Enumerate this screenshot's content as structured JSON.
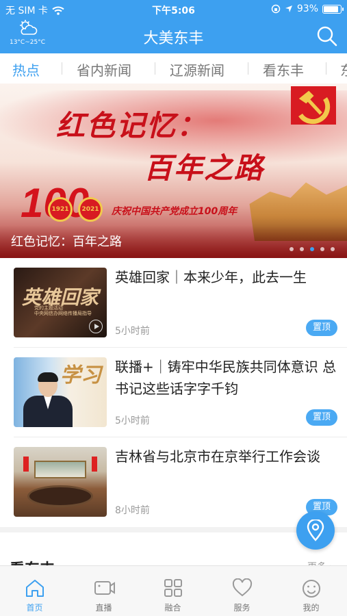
{
  "status_bar": {
    "carrier": "无 SIM 卡",
    "time": "下午5:06",
    "battery": "93%",
    "battery_level": 0.93
  },
  "header": {
    "title": "大美东丰",
    "weather_temp": "13°C~25°C",
    "weather_icon": "partly-cloudy-icon",
    "search_icon": "search-icon"
  },
  "tabs": [
    "热点",
    "省内新闻",
    "辽源新闻",
    "看东丰",
    "东"
  ],
  "active_tab": "热点",
  "banner": {
    "headline_1": "红色记忆：",
    "headline_2": "百年之路",
    "big_number": "100",
    "year_start": "1921",
    "year_end": "2021",
    "slogan": "庆祝中国共产党成立100周年",
    "caption": "红色记忆：百年之路",
    "slide_count": 5,
    "active_slide": 3
  },
  "news": [
    {
      "title": "英雄回家｜本来少年，此去一生",
      "time": "5小时前",
      "pin": "置顶",
      "thumb_text": "英雄回家",
      "thumb_sub": "中央网信办网络传播局指导",
      "thumb_sub_top": "党的主题活动",
      "thumb_icon": "play-icon"
    },
    {
      "title": "联播+｜铸牢中华民族共同体意识 总书记这些话字字千钧",
      "time": "5小时前",
      "pin": "置顶",
      "thumb_text": "学习"
    },
    {
      "title": "吉林省与北京市在京举行工作会谈",
      "time": "8小时前",
      "pin": "置顶"
    }
  ],
  "section": {
    "label": "看东丰",
    "more": "更多 ›"
  },
  "tabbar": [
    {
      "label": "首页",
      "icon": "home-icon",
      "active": true
    },
    {
      "label": "直播",
      "icon": "video-camera-icon",
      "active": false
    },
    {
      "label": "融合",
      "icon": "grid-icon",
      "active": false
    },
    {
      "label": "服务",
      "icon": "heart-icon",
      "active": false
    },
    {
      "label": "我的",
      "icon": "smile-face-icon",
      "active": false
    }
  ],
  "colors": {
    "accent": "#3da0f0",
    "banner_red": "#c8101a"
  }
}
